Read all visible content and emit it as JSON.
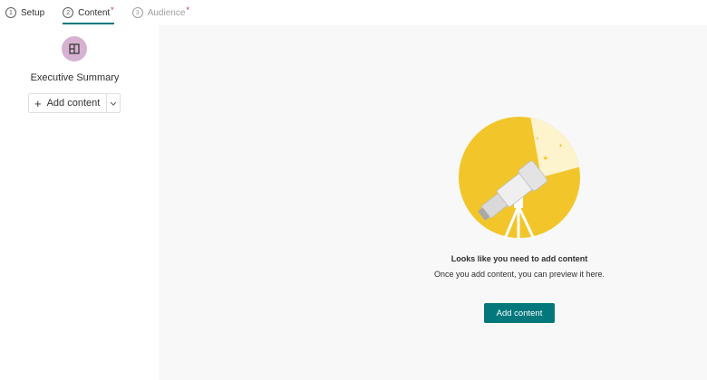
{
  "stepper": {
    "steps": [
      {
        "number": "1",
        "label": "Setup",
        "state": "completed",
        "required": ""
      },
      {
        "number": "2",
        "label": "Content",
        "state": "active",
        "required": "*"
      },
      {
        "number": "3",
        "label": "Audience",
        "state": "disabled",
        "required": "*"
      }
    ]
  },
  "left_pane": {
    "section_icon": "sections-icon",
    "section_title": "Executive Summary",
    "add_button_label": "Add content",
    "add_button_icon": "plus-icon",
    "chevron_icon": "chevron-down-icon"
  },
  "preview": {
    "illustration": "telescope-illustration",
    "empty_title": "Looks like you need to add content",
    "empty_subtitle": "Once you add content, you can preview it here.",
    "primary_button_label": "Add content"
  },
  "colors": {
    "accent": "#03787c",
    "illustration_yellow": "#f2c62a",
    "illustration_light": "#fdf3cc",
    "avatar_bg": "#d6b2d0",
    "preview_bg": "#f8f8f8",
    "required_star": "#c4314b"
  }
}
